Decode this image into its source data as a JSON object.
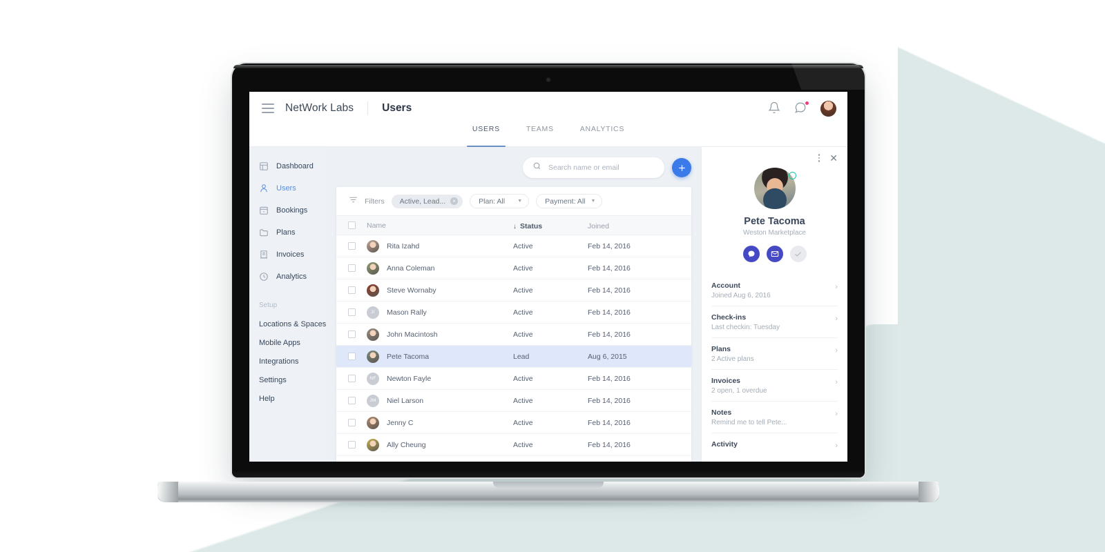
{
  "appbar": {
    "menu_icon": "hamburger-icon",
    "brand": "NetWork Labs",
    "page_title": "Users",
    "bell_icon": "bell-icon",
    "chat_icon": "chat-bubble-icon",
    "avatar": "user-avatar"
  },
  "tabs": [
    {
      "label": "USERS",
      "active": true
    },
    {
      "label": "TEAMS",
      "active": false
    },
    {
      "label": "ANALYTICS",
      "active": false
    }
  ],
  "sidebar": {
    "items": [
      {
        "label": "Dashboard",
        "icon": "dashboard-icon",
        "active": false
      },
      {
        "label": "Users",
        "icon": "user-icon",
        "active": true
      },
      {
        "label": "Bookings",
        "icon": "calendar-icon",
        "active": false
      },
      {
        "label": "Plans",
        "icon": "folder-icon",
        "active": false
      },
      {
        "label": "Invoices",
        "icon": "invoice-icon",
        "active": false
      },
      {
        "label": "Analytics",
        "icon": "clock-icon",
        "active": false
      }
    ],
    "section_label": "Setup",
    "setup_items": [
      {
        "label": "Locations & Spaces"
      },
      {
        "label": "Mobile Apps"
      },
      {
        "label": "Integrations"
      },
      {
        "label": "Settings"
      },
      {
        "label": "Help"
      }
    ]
  },
  "search": {
    "placeholder": "Search name or email",
    "value": "",
    "icon": "search-icon"
  },
  "add_button": {
    "label": "+",
    "color": "#3b7ae8"
  },
  "filters": {
    "label": "Filters",
    "icon": "filter-icon",
    "chip": {
      "label": "Active, Lead...",
      "clear": "×"
    },
    "selects": [
      {
        "label": "Plan: All"
      },
      {
        "label": "Payment: All"
      }
    ]
  },
  "table": {
    "columns": [
      {
        "key": "name",
        "label": "Name",
        "sorted": false
      },
      {
        "key": "status",
        "label": "Status",
        "sorted": true,
        "sort_arrow": "↓"
      },
      {
        "key": "joined",
        "label": "Joined",
        "sorted": false
      }
    ],
    "rows": [
      {
        "name": "Rita Izahd",
        "status": "Active",
        "joined": "Feb 14, 2016",
        "avatar_type": "photo",
        "avatar_color": "#c2a79a",
        "selected": false
      },
      {
        "name": "Anna Coleman",
        "status": "Active",
        "joined": "Feb 14, 2016",
        "avatar_type": "photo",
        "avatar_color": "#8f9e74",
        "selected": false
      },
      {
        "name": "Steve Wornaby",
        "status": "Active",
        "joined": "Feb 14, 2016",
        "avatar_type": "photo",
        "avatar_color": "#8c3a2a",
        "selected": false
      },
      {
        "name": "Mason Rally",
        "status": "Active",
        "joined": "Feb 14, 2016",
        "avatar_type": "initials",
        "initials": "JI",
        "selected": false
      },
      {
        "name": "John Macintosh",
        "status": "Active",
        "joined": "Feb 14, 2016",
        "avatar_type": "photo",
        "avatar_color": "#9a8d82",
        "selected": false
      },
      {
        "name": "Pete Tacoma",
        "status": "Lead",
        "joined": "Aug 6, 2015",
        "avatar_type": "photo",
        "avatar_color": "#7d8a7a",
        "selected": true
      },
      {
        "name": "Newton Fayle",
        "status": "Active",
        "joined": "Feb 14, 2016",
        "avatar_type": "initials",
        "initials": "NF",
        "selected": false
      },
      {
        "name": "Niel Larson",
        "status": "Active",
        "joined": "Feb 14, 2016",
        "avatar_type": "initials",
        "initials": "JM",
        "selected": false
      },
      {
        "name": "Jenny C",
        "status": "Active",
        "joined": "Feb 14, 2016",
        "avatar_type": "photo",
        "avatar_color": "#b08a6e",
        "selected": false
      },
      {
        "name": "Ally Cheung",
        "status": "Active",
        "joined": "Feb 14, 2016",
        "avatar_type": "photo",
        "avatar_color": "#c7b24e",
        "selected": false
      }
    ]
  },
  "panel": {
    "kebab_icon": "more-vertical-icon",
    "close_icon": "close-icon",
    "name": "Pete Tacoma",
    "subtitle": "Weston Marketplace",
    "online": true,
    "actions": [
      {
        "name": "message-action",
        "icon": "chat-bubble-icon",
        "style": "primary"
      },
      {
        "name": "email-action",
        "icon": "envelope-icon",
        "style": "primary"
      },
      {
        "name": "checkin-action",
        "icon": "check-icon",
        "style": "muted"
      }
    ],
    "items": [
      {
        "title": "Account",
        "sub": "Joined Aug 6, 2016"
      },
      {
        "title": "Check-ins",
        "sub": "Last checkin: Tuesday"
      },
      {
        "title": "Plans",
        "sub": "2 Active plans"
      },
      {
        "title": "Invoices",
        "sub": "2 open, 1 overdue"
      },
      {
        "title": "Notes",
        "sub": "Remind me to tell Pete..."
      },
      {
        "title": "Activity",
        "sub": ""
      }
    ],
    "chevron": "›"
  },
  "theme": {
    "accent_blue": "#3b7ae8",
    "active_nav": "#5b8ddb",
    "selected_row": "#dfe7fb",
    "online_green": "#19c8a8",
    "badge_pink": "#ef3d7a",
    "action_indigo": "#4549c4",
    "background_mint": "#dde9e8"
  }
}
